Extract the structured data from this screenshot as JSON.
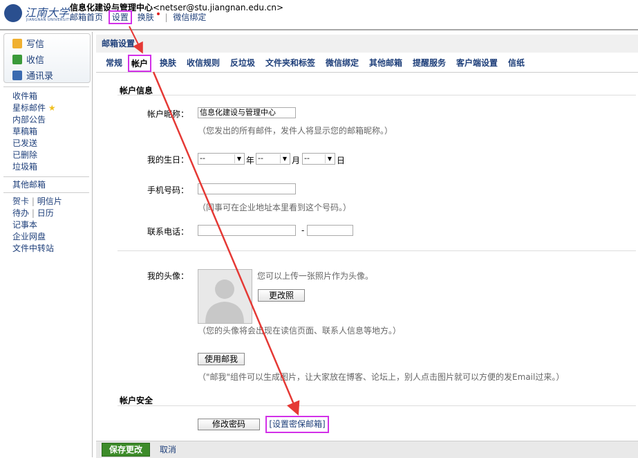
{
  "header": {
    "logo_text": "江南大学",
    "logo_sub": "JIANGNAN UNIVERSITY",
    "account_name": "信息化建设与管理中心",
    "account_email": "<netser@stu.jiangnan.edu.cn>",
    "links": [
      "邮箱首页",
      "设置",
      "换肤",
      "微信绑定"
    ],
    "separator": "|"
  },
  "sidebar": {
    "compose": "写信",
    "inbox": "收信",
    "contacts": "通讯录",
    "folders": [
      "收件箱",
      "星标邮件",
      "内部公告",
      "草稿箱",
      "已发送",
      "已删除",
      "垃圾箱"
    ],
    "other_mailbox": "其他邮箱",
    "tools": [
      [
        "贺卡",
        "明信片"
      ],
      [
        "待办",
        "日历"
      ]
    ],
    "tools_single": [
      "记事本",
      "企业网盘",
      "文件中转站"
    ]
  },
  "main": {
    "title": "邮箱设置",
    "tabs": [
      "常规",
      "帐户",
      "换肤",
      "收信规则",
      "反垃圾",
      "文件夹和标签",
      "微信绑定",
      "其他邮箱",
      "提醒服务",
      "客户端设置",
      "信纸"
    ],
    "active_tab": "帐户",
    "account_info": {
      "title": "帐户信息",
      "nickname_label": "帐户昵称：",
      "nickname_value": "信息化建设与管理中心",
      "nickname_hint": "（您发出的所有邮件，发件人将显示您的邮箱昵称。）",
      "birthday_label": "我的生日：",
      "birthday_year": "--",
      "birthday_year_unit": "年",
      "birthday_month": "--",
      "birthday_month_unit": "月",
      "birthday_day": "--",
      "birthday_day_unit": "日",
      "mobile_label": "手机号码：",
      "mobile_hint": "（同事可在企业地址本里看到这个号码。）",
      "phone_label": "联系电话：",
      "phone_dash": "-",
      "avatar_label": "我的头像：",
      "avatar_hint": "您可以上传一张照片作为头像。",
      "change_photo": "更改照",
      "avatar_hint2": "（您的头像将会出现在读信页面、联系人信息等地方。）",
      "use_me_btn": "使用邮我",
      "use_me_hint": "（\"邮我\"组件可以生成图片，让大家放在博客、论坛上，别人点击图片就可以方便的发Email过来。）"
    },
    "account_security": {
      "title": "帐户安全",
      "change_password": "修改密码",
      "set_security_mail": "[设置密保邮箱]"
    },
    "footer": {
      "save": "保存更改",
      "cancel": "取消"
    }
  },
  "colors": {
    "highlight": "#d230e8",
    "arrow": "#e53935",
    "link": "#1e3f7a",
    "save_green": "#3d8b2a"
  }
}
